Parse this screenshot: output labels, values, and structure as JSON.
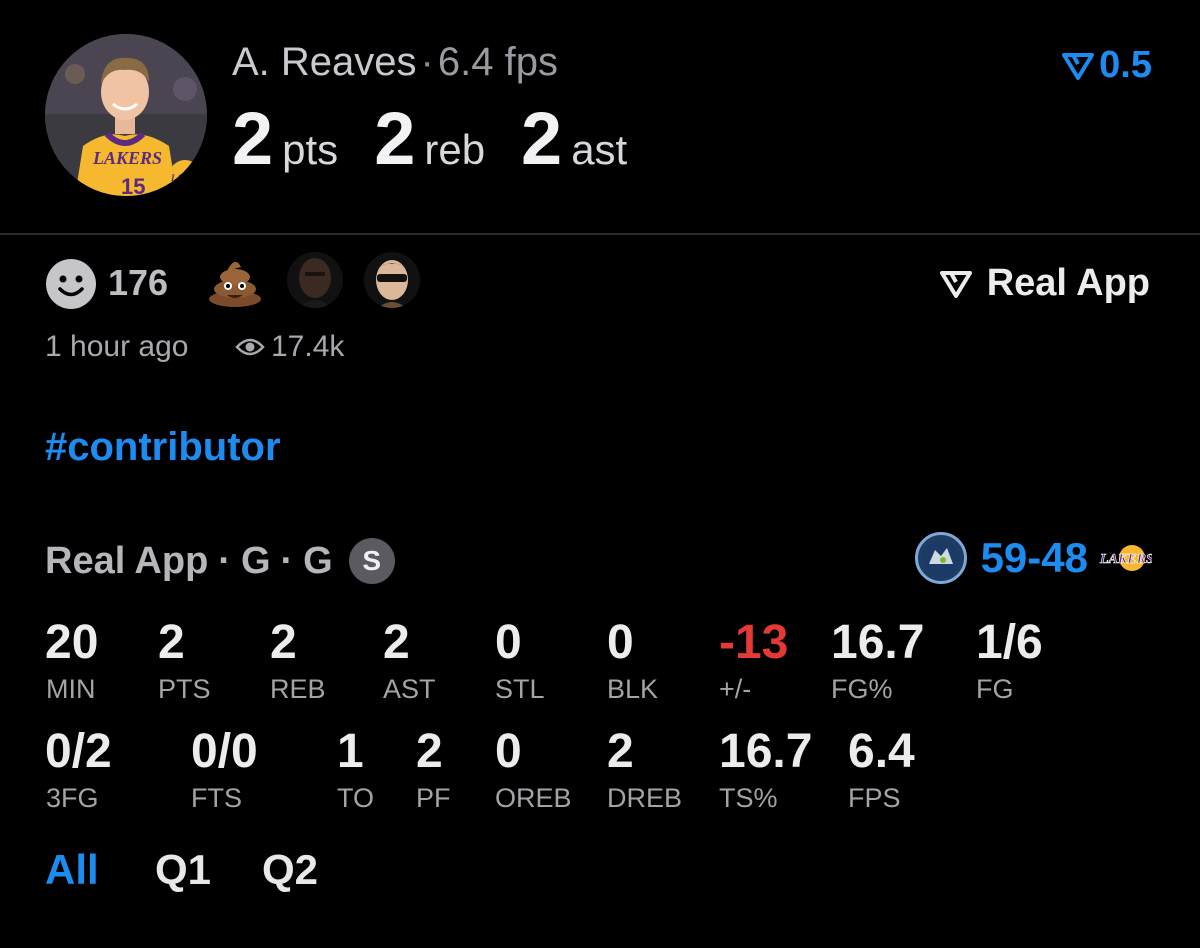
{
  "player": {
    "name": "A. Reaves",
    "separator": "·",
    "fps_text": "6.4 fps",
    "team_logo_text": "LAKERS",
    "jersey_text": "LAKERS",
    "jersey_number": "15",
    "totals": [
      {
        "num": "2",
        "unit": "pts"
      },
      {
        "num": "2",
        "unit": "reb"
      },
      {
        "num": "2",
        "unit": "ast"
      }
    ]
  },
  "rating": {
    "value": "0.5",
    "icon": "real-logo-icon",
    "color": "#1d8cf0"
  },
  "reactions": {
    "count": "176",
    "icons": [
      "smile-icon",
      "poop-emoji",
      "player-face-1",
      "player-face-2"
    ]
  },
  "brand": {
    "label": "Real App",
    "icon": "real-logo-icon"
  },
  "meta": {
    "time": "1 hour ago",
    "views": "17.4k"
  },
  "hashtag": "#contributor",
  "game": {
    "source": "Real App",
    "sep": "·",
    "pos1": "G",
    "pos2": "G",
    "badge": "S",
    "score": "59-48",
    "home_icon": "timberwolves-logo",
    "away_icon": "lakers-logo"
  },
  "stats_row1": [
    {
      "value": "20",
      "label": "MIN"
    },
    {
      "value": "2",
      "label": "PTS"
    },
    {
      "value": "2",
      "label": "REB"
    },
    {
      "value": "2",
      "label": "AST"
    },
    {
      "value": "0",
      "label": "STL"
    },
    {
      "value": "0",
      "label": "BLK"
    },
    {
      "value": "-13",
      "label": "+/-"
    },
    {
      "value": "16.7",
      "label": "FG%"
    },
    {
      "value": "1/6",
      "label": "FG"
    }
  ],
  "stats_row2": [
    {
      "value": "0/2",
      "label": "3FG"
    },
    {
      "value": "0/0",
      "label": "FTS"
    },
    {
      "value": "1",
      "label": "TO"
    },
    {
      "value": "2",
      "label": "PF"
    },
    {
      "value": "0",
      "label": "OREB"
    },
    {
      "value": "2",
      "label": "DREB"
    },
    {
      "value": "16.7",
      "label": "TS%"
    },
    {
      "value": "6.4",
      "label": "FPS"
    }
  ],
  "tabs": [
    "All",
    "Q1",
    "Q2"
  ],
  "colors": {
    "accent": "#1d8cf0",
    "negative": "#e53935",
    "background": "#000000"
  }
}
